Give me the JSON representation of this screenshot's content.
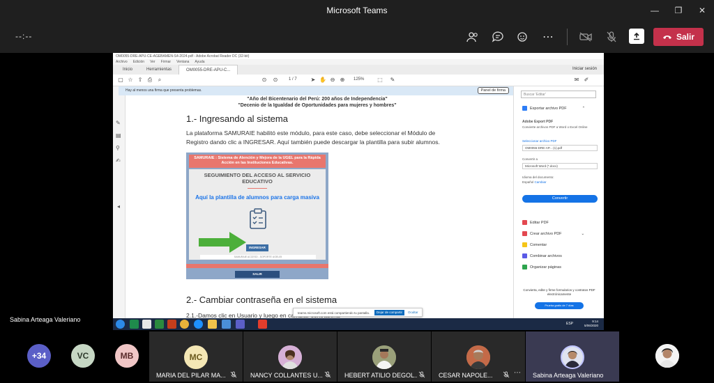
{
  "window": {
    "title": "Microsoft Teams"
  },
  "meeting": {
    "timer": "--:--",
    "leave_label": "Salir"
  },
  "presenter": {
    "name": "Sabina Arteaga Valeriano"
  },
  "reader": {
    "title_bar": "OM0055-DRE-APU-CE-AGEBAMEN-S4-2024.pdf - Adobe Acrobat Reader DC (32-bit)",
    "menu": [
      "Archivo",
      "Edición",
      "Ver",
      "Firmar",
      "Ventana",
      "Ayuda"
    ],
    "tabs": [
      "Inicio",
      "Herramientas",
      "OM0055-DRE-APU-C..."
    ],
    "sign_in": "Iniciar sesión",
    "page_indicator": "1 / 7",
    "zoom": "125%",
    "sign_notice": "Hay al menos una firma que presenta problemas.",
    "sign_panel": "Panel de firma"
  },
  "document": {
    "header1": "\"Año del Bicentenario del Perú: 200 años de Independencia\"",
    "header2": "\"Decenio de la Igualdad de Oportunidades para mujeres y hombres\"",
    "section1": "1.- Ingresando al sistema",
    "para1": "La plataforma SAMURAIE habilitó este módulo, para este caso, debe seleccionar el Módulo de Registro dando clic a INGRESAR. Aquí también puede descargar la plantilla para subir alumnos.",
    "section2": "2.- Cambiar contraseña en el sistema",
    "para2": "2.1.-Damos clic en Usuario y luego en cambiar contraseña"
  },
  "samurai": {
    "header": "SAMURAIE : Sistema de Alención y Mejora de la UGEL para la Rápida Acción en las Instituciones Educativas.",
    "subtitle": "SEGUIMIENTO DEL ACCESO AL SERVICIO EDUCATIVO",
    "link": "Aquí la plantilla de alumnos para carga masiva",
    "ingresar": "INGRESAR",
    "footer": "SAMURAIE ACCESO - SOPORTE UGEL05",
    "salir": "SALIR"
  },
  "share_banner": {
    "message": "teams.microsoft.com está compartiendo tu pantalla.",
    "stop": "Dejar de compartir",
    "hide": "Ocultar"
  },
  "right_pane": {
    "search": "Buscar 'Editar'",
    "export": "Exportar archivo PDF",
    "export_title": "Adobe Export PDF",
    "export_desc": "Convierte archivos PDF a Word o Excel Online",
    "select_label": "Seleccionar archivo PDF",
    "file": "OM0055-DRE-AP... (1).pdf",
    "convert_to": "Convertir a",
    "format": "Microsoft Word (*.docx)",
    "lang_label": "Idioma del documento:",
    "lang_value": "Español",
    "lang_change": "Cambiar",
    "convert_btn": "Convertir",
    "tools": [
      "Editar PDF",
      "Crear archivo PDF",
      "Comentar",
      "Combinar archivos",
      "Organizar páginas"
    ],
    "promo": "Convierta, edite y firme formularios y contratos PDF electrónicamente",
    "trial": "Prueba gratis de 7 días"
  },
  "taskbar": {
    "time": "9:14",
    "date": "5/06/2020",
    "lang": "ESP"
  },
  "gallery": {
    "mini": [
      {
        "label": "+34",
        "color": "#5b5fc7"
      },
      {
        "label": "VC",
        "color": "#c6d7c4"
      },
      {
        "label": "MB",
        "color": "#f0c6c6"
      }
    ],
    "tiles": [
      {
        "initials": "MC",
        "name": "MARIA DEL PILAR MA...",
        "color": "#f4e7b5"
      },
      {
        "initials": "",
        "name": "NANCY COLLANTES U...",
        "color": "#c9a7c9"
      },
      {
        "initials": "",
        "name": "HEBERT ATILIO DEGOL...",
        "color": "#8c8c6c"
      },
      {
        "initials": "",
        "name": "CESAR NAPOLE...",
        "color": "#b58d6d"
      },
      {
        "initials": "",
        "name": "Sabina Arteaga Valeriano",
        "color": "#a9b6d9"
      }
    ]
  },
  "colors": {
    "leave": "#c4314b",
    "accent": "#5b5fc7",
    "acrobat_blue": "#1473e6"
  }
}
